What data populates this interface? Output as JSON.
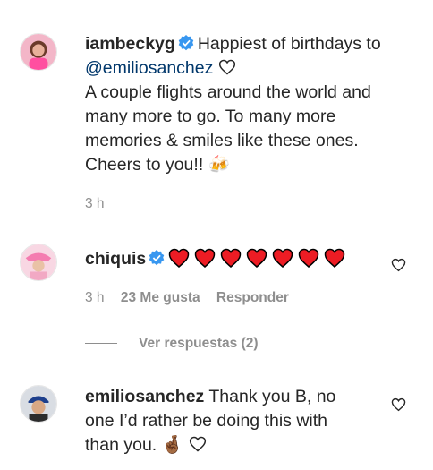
{
  "post_caption": {
    "username": "iambeckyg",
    "text_line1": "Happiest of birthdays to",
    "mention": "@emiliosanchez",
    "text_rest": [
      "A couple flights around the world and",
      "many more to go. To many more",
      "memories & smiles like these ones.",
      "Cheers to you!! "
    ],
    "emoji_end": "🍻",
    "time": "3 h"
  },
  "comments": [
    {
      "username": "chiquis",
      "hearts_count": 7,
      "time": "3 h",
      "likes": "23 Me gusta",
      "reply_label": "Responder",
      "view_replies": "Ver respuestas (2)"
    },
    {
      "username": "emiliosanchez",
      "text_lines": [
        "Thank you B, no",
        "one I’d rather be doing this with",
        "than you. "
      ],
      "emoji_end": "🤞🏾"
    }
  ],
  "colors": {
    "verified": "#3897f0",
    "heart_red": "#ed1c24",
    "muted": "#8e8e8e",
    "mention": "#00376b"
  }
}
